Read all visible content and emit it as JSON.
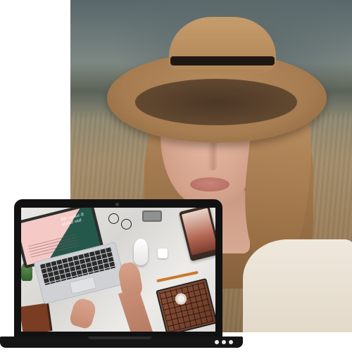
{
  "portrait_photo": {
    "subject": "portrait-of-woman-in-hat",
    "colors": {
      "hat": "#b08556",
      "band": "#1f1712",
      "hair": "#b48a5c",
      "eyes": "#5f86a2",
      "sky": "#59676b",
      "field": "#9f8461"
    }
  },
  "laptop_mockup": {
    "screen_content": {
      "mini_laptop_text": "We make it stand out",
      "colors": {
        "pink_panel": "#f5c9c5",
        "green_panel": "#24584a",
        "marble": "#e9e8e5",
        "leather": "#8a4e34",
        "pencil": "#c8782e"
      }
    },
    "frame_color": "#111111",
    "indicator_dots": 3
  }
}
